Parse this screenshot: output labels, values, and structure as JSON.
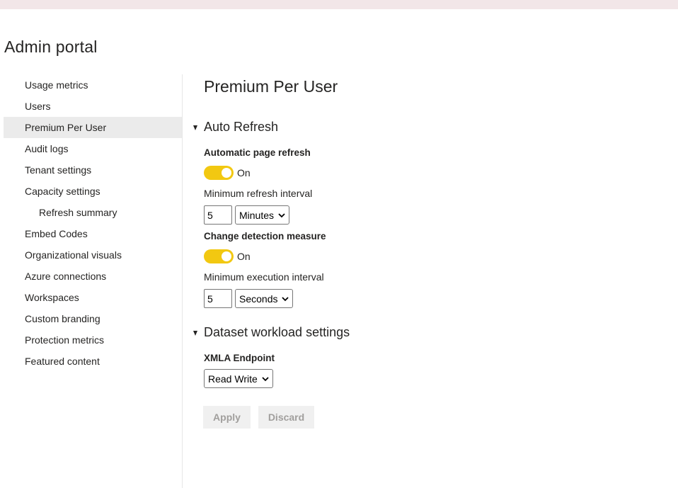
{
  "portal_title": "Admin portal",
  "sidebar": {
    "items": [
      {
        "label": "Usage metrics"
      },
      {
        "label": "Users"
      },
      {
        "label": "Premium Per User"
      },
      {
        "label": "Audit logs"
      },
      {
        "label": "Tenant settings"
      },
      {
        "label": "Capacity settings"
      },
      {
        "label": "Refresh summary"
      },
      {
        "label": "Embed Codes"
      },
      {
        "label": "Organizational visuals"
      },
      {
        "label": "Azure connections"
      },
      {
        "label": "Workspaces"
      },
      {
        "label": "Custom branding"
      },
      {
        "label": "Protection metrics"
      },
      {
        "label": "Featured content"
      }
    ],
    "active": "Premium Per User"
  },
  "main": {
    "title": "Premium Per User",
    "auto_refresh": {
      "section_title": "Auto Refresh",
      "automatic_page_refresh": {
        "label": "Automatic page refresh",
        "toggle_state": "On",
        "interval_label": "Minimum refresh interval",
        "interval_value": "5",
        "interval_unit": "Minutes"
      },
      "change_detection": {
        "label": "Change detection measure",
        "toggle_state": "On",
        "interval_label": "Minimum execution interval",
        "interval_value": "5",
        "interval_unit": "Seconds"
      }
    },
    "dataset_workload": {
      "section_title": "Dataset workload settings",
      "xmla_label": "XMLA Endpoint",
      "xmla_value": "Read Write"
    },
    "actions": {
      "apply": "Apply",
      "discard": "Discard"
    }
  },
  "colors": {
    "toggle_on": "#f2c811",
    "active_nav_bg": "#ebebeb",
    "topbar": "#f2e6e8",
    "disabled_button_bg": "#f0f0f0",
    "disabled_button_text": "#a19f9d"
  }
}
